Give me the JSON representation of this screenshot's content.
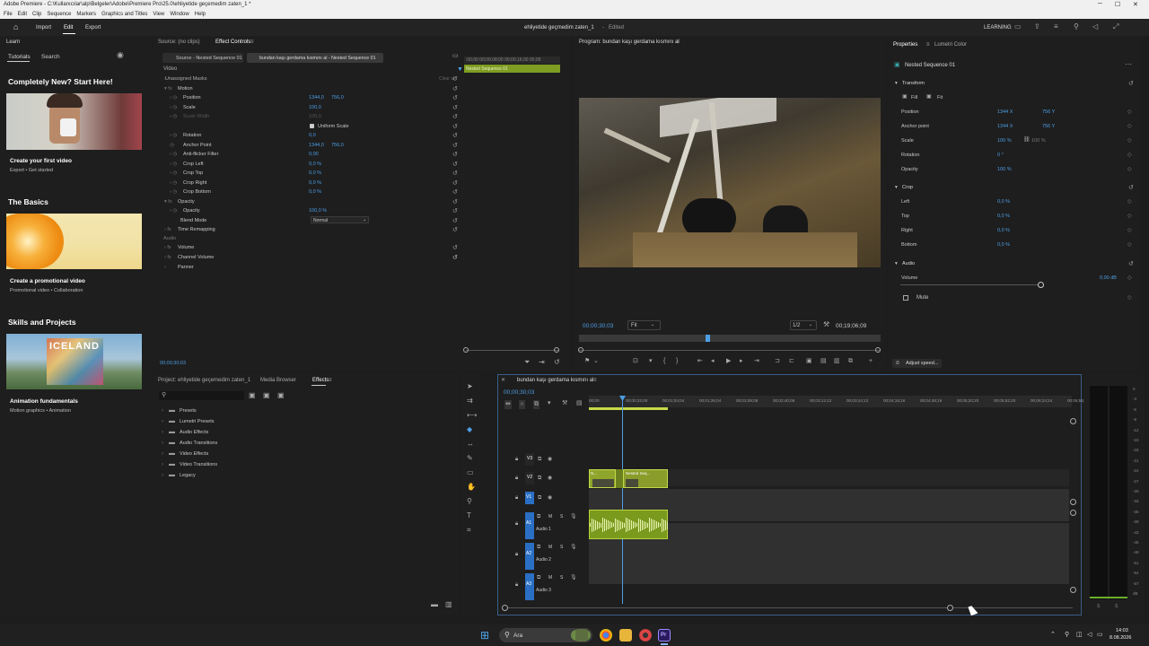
{
  "window": {
    "title": "Adobe Premiere - C:\\Kullanıcılar\\alp\\Belgeler\\Adobe\\Premiere Pro\\25.0\\ehliyetide geçemedim zaten_1 *"
  },
  "window_controls": {
    "minimize": "─",
    "maximize": "☐",
    "close": "✕"
  },
  "menu": [
    "File",
    "Edit",
    "Clip",
    "Sequence",
    "Markers",
    "Graphics and Titles",
    "View",
    "Window",
    "Help"
  ],
  "header": {
    "tabs": [
      "Import",
      "Edit",
      "Export"
    ],
    "active_tab": "Edit",
    "project_title": "ehliyetide geçmedim zaten_1",
    "status": "Edited",
    "workspace": "LEARNING"
  },
  "learn": {
    "panel_title": "Learn",
    "tabs": [
      "Tutorials",
      "Search"
    ],
    "sections": [
      {
        "heading": "Completely New? Start Here!",
        "card_title": "Create your first video",
        "card_sub": "Export • Get started"
      },
      {
        "heading": "The Basics",
        "card_title": "Create a promotional video",
        "card_sub": "Promotional video • Collaboration"
      },
      {
        "heading": "Skills and Projects",
        "card_title": "Animation fundamentals",
        "card_sub": "Motion graphics • Animation",
        "thumb_text": "ICELAND"
      }
    ]
  },
  "effect_controls": {
    "tabs": [
      "Source: (no clips)",
      "Effect Controls"
    ],
    "source_label": "Source - Nested Sequence 01",
    "clip_label": "bundan kaşı gerdama kısmını al - Nested Sequence 01",
    "mini_ruler": ":00;00  00;00;08;00  00;00;16;00  00;00",
    "mini_clip": "Nested Sequence 01",
    "video_label": "Video",
    "masks_label": "Unassigned Masks",
    "clear_all": "Clear all",
    "motion": "Motion",
    "position": "Position",
    "position_x": "1344,0",
    "position_y": "756,0",
    "scale": "Scale",
    "scale_val": "100,0",
    "scale_width": "Scale Width",
    "scale_width_val": "100,0",
    "uniform": "Uniform Scale",
    "rotation": "Rotation",
    "rotation_val": "0,0",
    "anchor": "Anchor Point",
    "anchor_x": "1344,0",
    "anchor_y": "756,0",
    "antiflicker": "Anti-flicker Filter",
    "antiflicker_val": "0,00",
    "crop_left": "Crop Left",
    "crop_left_val": "0,0 %",
    "crop_top": "Crop Top",
    "crop_top_val": "0,0 %",
    "crop_right": "Crop Right",
    "crop_right_val": "0,0 %",
    "crop_bottom": "Crop Bottom",
    "crop_bottom_val": "0,0 %",
    "opacity_group": "Opacity",
    "opacity": "Opacity",
    "opacity_val": "100,0 %",
    "blend": "Blend Mode",
    "blend_val": "Normal",
    "time_remap": "Time Remapping",
    "audio_label": "Audio",
    "volume": "Volume",
    "channel_volume": "Channel Volume",
    "panner": "Panner",
    "timecode": "00;00;30;03"
  },
  "program": {
    "title": "Program: bundan kaşı gerdama kısmını al",
    "timecode": "00;00;30;03",
    "fit": "Fit",
    "quality": "1/2",
    "duration": "00;19;06;09"
  },
  "properties": {
    "tabs": [
      "Properties",
      "Lumetri Color"
    ],
    "item": "Nested Sequence 01",
    "transform": "Transform",
    "fill": "Fill",
    "fit": "Fit",
    "position": "Position",
    "pos_x": "1344 X",
    "pos_y": "756 Y",
    "anchor": "Anchor point",
    "anc_x": "1344 X",
    "anc_y": "756 Y",
    "scale": "Scale",
    "scale_val": "100 %",
    "scale_val2": "100 %",
    "rotation": "Rotation",
    "rotation_val": "0 °",
    "opacity": "Opacity",
    "opacity_val": "100 %",
    "crop": "Crop",
    "left": "Left",
    "left_val": "0,0 %",
    "top": "Top",
    "top_val": "0,0 %",
    "right": "Right",
    "right_val": "0,0 %",
    "bottom": "Bottom",
    "bottom_val": "0,0 %",
    "audio": "Audio",
    "volume": "Volume",
    "volume_val": "0,00 dB",
    "mute": "Mute",
    "adjust_speed": "Adjust speed..."
  },
  "project": {
    "tabs": [
      "Project: ehliyetide geçemedim zaten_1",
      "Media Browser",
      "Effects"
    ],
    "active_tab": "Effects",
    "folders": [
      "Presets",
      "Lumetri Presets",
      "Audio Effects",
      "Audio Transitions",
      "Video Effects",
      "Video Transitions",
      "Legacy"
    ]
  },
  "timeline": {
    "sequence": "bundan kaşı gerdama kısmını al",
    "timecode": "00;00;30;03",
    "ruler": [
      "00;00",
      "00;00;32;00",
      "00;01;04;04",
      "00;01;36;04",
      "00;02;08;08",
      "00;02;40;08",
      "00;03;12;12",
      "00;03;44;12",
      "00;04;16;16",
      "00;04;48;16",
      "00;05;20;20",
      "00;05;52;20",
      "00;06;24;24",
      "00;06;56;"
    ],
    "tracks": [
      "V3",
      "V2",
      "V1",
      "A1",
      "A2",
      "A3"
    ],
    "audio_names": [
      "Audio 1",
      "Audio 2",
      "Audio 3"
    ],
    "clip_v2a": "N...",
    "clip_v2b": "Nested Seq..."
  },
  "meter": {
    "scale": [
      "0",
      "-3",
      "-6",
      "-9",
      "-12",
      "-15",
      "-18",
      "-21",
      "-24",
      "-27",
      "-30",
      "-33",
      "-36",
      "-39",
      "-42",
      "-45",
      "-48",
      "-51",
      "-54",
      "-57",
      "dB"
    ],
    "s": [
      "S",
      "S"
    ]
  },
  "taskbar": {
    "search": "Ara",
    "time": "14:03",
    "date": "8.08.2026"
  }
}
